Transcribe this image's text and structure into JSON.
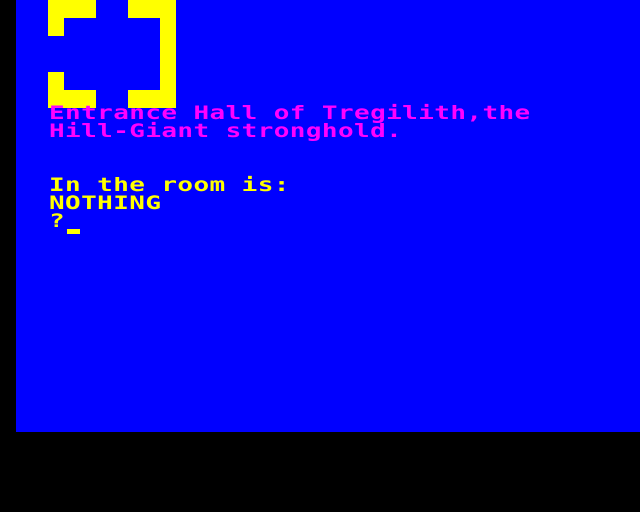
{
  "colors": {
    "background": "#0000FF",
    "border": "#000000",
    "room_title": "#FF00FF",
    "room_contents": "#FFFF00",
    "map": "#FFFF00"
  },
  "room": {
    "title_line_1": "Entrance Hall of Tregilith,the",
    "title_line_2": "Hill-Giant stronghold.",
    "contents_label": "In the room is:",
    "contents_value": "NOTHING"
  },
  "input": {
    "prompt": "?",
    "cursor_icon": "block-cursor-icon"
  },
  "map": {
    "icon": "room-exits-map-icon"
  }
}
